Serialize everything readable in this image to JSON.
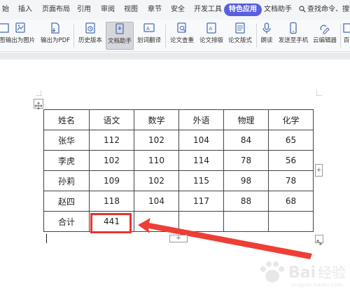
{
  "menu": {
    "tabs": [
      {
        "label": "始"
      },
      {
        "label": "插入"
      },
      {
        "label": "页面布局"
      },
      {
        "label": "引用"
      },
      {
        "label": "审阅"
      },
      {
        "label": "视图"
      },
      {
        "label": "章节"
      },
      {
        "label": "安全"
      },
      {
        "label": "开发工具"
      },
      {
        "label": "特色应用"
      },
      {
        "label": "文档助手"
      }
    ],
    "search_label": "查找命令、搜索"
  },
  "ribbon": {
    "tools": [
      {
        "label": "图"
      },
      {
        "label": "输出为图片"
      },
      {
        "label": "输出为PDF"
      },
      {
        "label": "历史版本"
      },
      {
        "label": "文档助手"
      },
      {
        "label": "划词翻译"
      },
      {
        "label": "论文查重"
      },
      {
        "label": "论文排版"
      },
      {
        "label": "论文版式"
      },
      {
        "label": "朗读"
      },
      {
        "label": "发送至手机"
      },
      {
        "label": "云编辑器"
      },
      {
        "label": "百"
      }
    ]
  },
  "table": {
    "rows": [
      [
        "姓名",
        "语文",
        "数学",
        "外语",
        "物理",
        "化学"
      ],
      [
        "张华",
        "112",
        "102",
        "104",
        "84",
        "65"
      ],
      [
        "李虎",
        "102",
        "110",
        "114",
        "78",
        "56"
      ],
      [
        "孙莉",
        "109",
        "102",
        "115",
        "98",
        "78"
      ],
      [
        "赵四",
        "118",
        "104",
        "117",
        "88",
        "68"
      ],
      [
        "合计",
        "441",
        "",
        "",
        "",
        ""
      ]
    ]
  },
  "controls": {
    "side_plus": "+",
    "bottom_plus": "+"
  },
  "colors": {
    "accent": "#5a5fe0",
    "highlight": "#e8342c"
  }
}
